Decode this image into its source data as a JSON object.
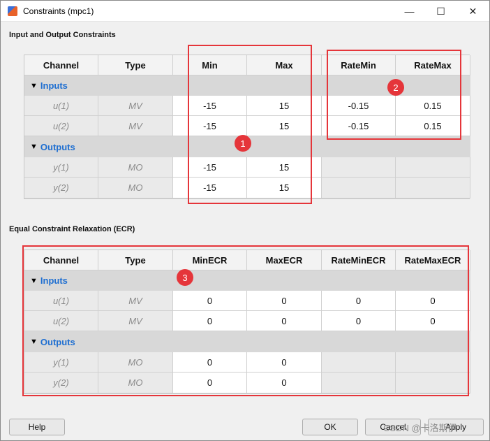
{
  "window": {
    "title": "Constraints (mpc1)",
    "minimize": "—",
    "maximize": "☐",
    "close": "✕"
  },
  "io": {
    "section_title": "Input and Output Constraints",
    "headers": [
      "Channel",
      "Type",
      "Min",
      "Max",
      "RateMin",
      "RateMax"
    ],
    "inputs_label": "Inputs",
    "outputs_label": "Outputs",
    "inputs": [
      {
        "channel": "u(1)",
        "type": "MV",
        "min": "-15",
        "max": "15",
        "ratemin": "-0.15",
        "ratemax": "0.15"
      },
      {
        "channel": "u(2)",
        "type": "MV",
        "min": "-15",
        "max": "15",
        "ratemin": "-0.15",
        "ratemax": "0.15"
      }
    ],
    "outputs": [
      {
        "channel": "y(1)",
        "type": "MO",
        "min": "-15",
        "max": "15"
      },
      {
        "channel": "y(2)",
        "type": "MO",
        "min": "-15",
        "max": "15"
      }
    ]
  },
  "ecr": {
    "section_title": "Equal Constraint Relaxation (ECR)",
    "headers": [
      "Channel",
      "Type",
      "MinECR",
      "MaxECR",
      "RateMinECR",
      "RateMaxECR"
    ],
    "inputs_label": "Inputs",
    "outputs_label": "Outputs",
    "inputs": [
      {
        "channel": "u(1)",
        "type": "MV",
        "minecr": "0",
        "maxecr": "0",
        "rateminecr": "0",
        "ratemaxecr": "0"
      },
      {
        "channel": "u(2)",
        "type": "MV",
        "minecr": "0",
        "maxecr": "0",
        "rateminecr": "0",
        "ratemaxecr": "0"
      }
    ],
    "outputs": [
      {
        "channel": "y(1)",
        "type": "MO",
        "minecr": "0",
        "maxecr": "0"
      },
      {
        "channel": "y(2)",
        "type": "MO",
        "minecr": "0",
        "maxecr": "0"
      }
    ]
  },
  "annotations": {
    "badge1": "1",
    "badge2": "2",
    "badge3": "3",
    "highlight_color": "#e5353a"
  },
  "buttons": {
    "help": "Help",
    "ok": "OK",
    "cancel": "Cancel",
    "apply": "Apply"
  },
  "watermark": "CSDN @卡洛斯伊"
}
